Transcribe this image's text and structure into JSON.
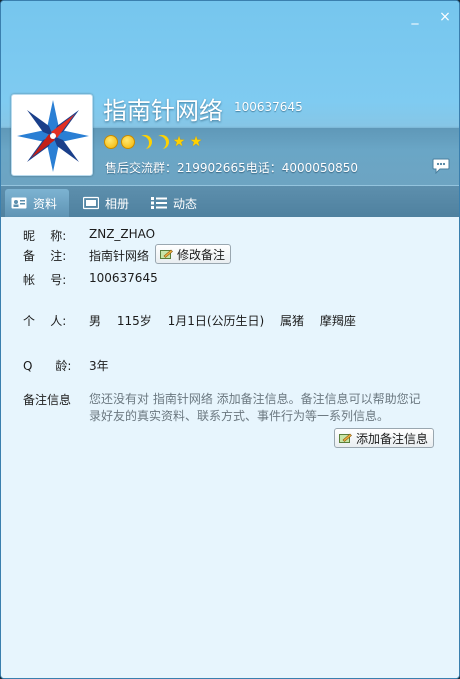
{
  "window": {
    "minimize_label": "_",
    "close_label": "×"
  },
  "profile": {
    "nickname": "指南针网络",
    "qq_number": "100637645",
    "level_icons": [
      "sun-icon",
      "sun-icon",
      "moon-icon",
      "moon-icon",
      "star-icon",
      "star-icon"
    ],
    "signature": "售后交流群：219902665电话：4000050850"
  },
  "tabs": [
    {
      "label": "资料",
      "icon": "profile-card-icon",
      "active": true
    },
    {
      "label": "相册",
      "icon": "photo-album-icon",
      "active": false
    },
    {
      "label": "动态",
      "icon": "feed-list-icon",
      "active": false
    }
  ],
  "details": {
    "nickname_label": "昵    称:",
    "nickname_value": "ZNZ_ZHAO",
    "remark_label": "备    注:",
    "remark_value": "指南针网络",
    "edit_remark_button": "修改备注",
    "account_label": "帐    号:",
    "account_value": "100637645",
    "personal_label": "个    人:",
    "personal": {
      "gender": "男",
      "age": "115岁",
      "birthday": "1月1日(公历生日)",
      "zodiac": "属猪",
      "constellation": "摩羯座"
    },
    "qage_label": "Q      龄:",
    "qage_value": "3年",
    "note_label": "备注信息",
    "note_text": "您还没有对 指南针网络 添加备注信息。备注信息可以帮助您记录好友的真实资料、联系方式、事件行为等一系列信息。",
    "add_note_button": "添加备注信息"
  },
  "colors": {
    "header": "#7fcbf1",
    "tab_bar": "#5588a6",
    "content_bg": "#e7f5fd",
    "star": "#ffd200"
  }
}
